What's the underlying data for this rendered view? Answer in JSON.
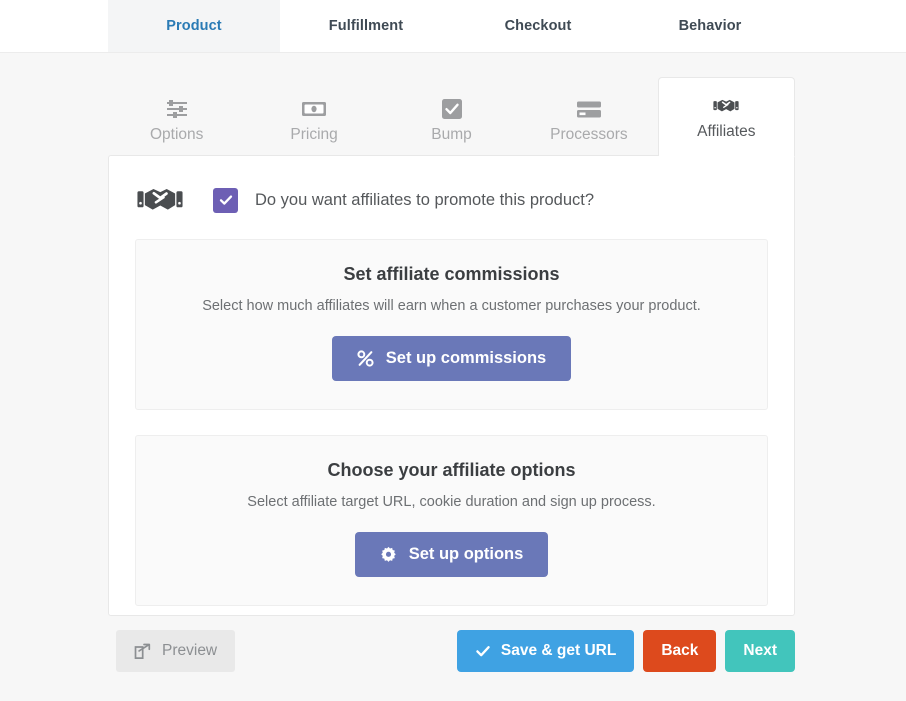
{
  "top_tabs": [
    {
      "label": "Product",
      "active": true,
      "name": "tab-product"
    },
    {
      "label": "Fulfillment",
      "active": false,
      "name": "tab-fulfillment"
    },
    {
      "label": "Checkout",
      "active": false,
      "name": "tab-checkout"
    },
    {
      "label": "Behavior",
      "active": false,
      "name": "tab-behavior"
    }
  ],
  "sub_tabs": [
    {
      "label": "Options",
      "icon": "sliders-icon",
      "active": false
    },
    {
      "label": "Pricing",
      "icon": "money-bill-icon",
      "active": false
    },
    {
      "label": "Bump",
      "icon": "checkbox-icon",
      "active": false
    },
    {
      "label": "Processors",
      "icon": "credit-card-icon",
      "active": false
    },
    {
      "label": "Affiliates",
      "icon": "handshake-icon",
      "active": true
    }
  ],
  "question": {
    "icon": "handshake-icon",
    "text": "Do you want affiliates to promote this product?",
    "checked": true
  },
  "panels": [
    {
      "title": "Set affiliate commissions",
      "subtitle": "Select how much affiliates will earn when a customer purchases your product.",
      "button_label": "Set up commissions",
      "button_icon": "percent-icon"
    },
    {
      "title": "Choose your affiliate options",
      "subtitle": "Select affiliate target URL, cookie duration and sign up process.",
      "button_label": "Set up options",
      "button_icon": "gear-icon"
    }
  ],
  "footer": {
    "preview_label": "Preview",
    "preview_icon": "external-link-icon",
    "save_label": "Save & get URL",
    "save_icon": "check-icon",
    "back_label": "Back",
    "next_label": "Next"
  },
  "colors": {
    "accent_purple": "#6d5fb4",
    "panel_button": "#6a78b8",
    "save_blue": "#3fa2e3",
    "back_orange": "#dd4a1d",
    "next_teal": "#42c5bc",
    "active_tab_text": "#2a7bb5"
  }
}
